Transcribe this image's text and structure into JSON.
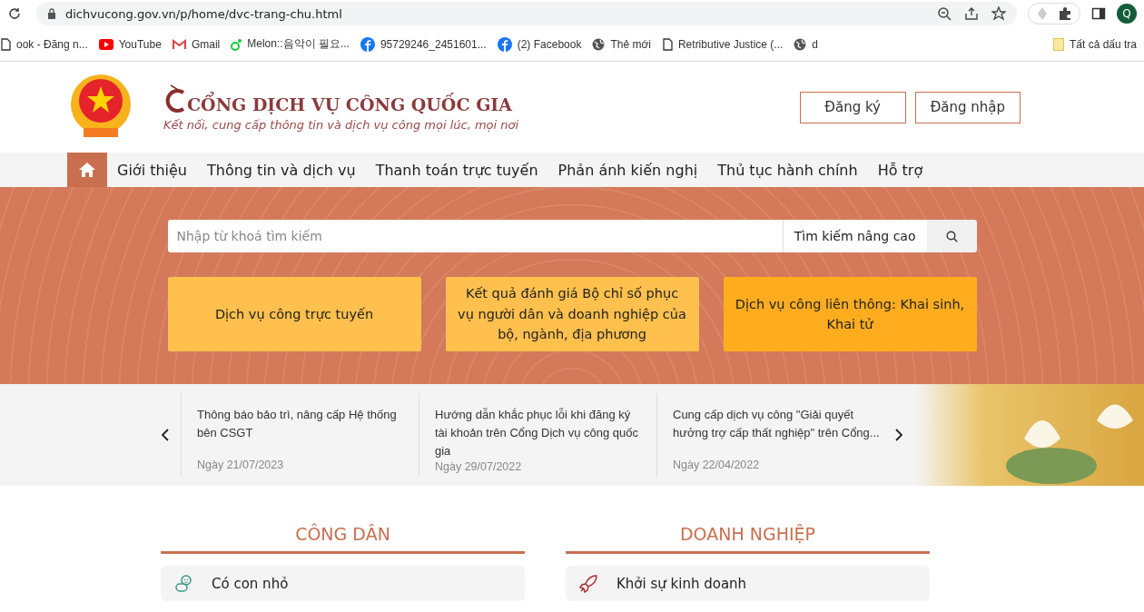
{
  "browser": {
    "url": "dichvucong.gov.vn/p/home/dvc-trang-chu.html",
    "profile_initial": "Q",
    "bookmarks": [
      {
        "label": "ook - Đăng n...",
        "kind": "page"
      },
      {
        "label": "YouTube",
        "kind": "youtube"
      },
      {
        "label": "Gmail",
        "kind": "gmail"
      },
      {
        "label": "Melon::음악이 필요...",
        "kind": "melon"
      },
      {
        "label": "95729246_2451601...",
        "kind": "facebook"
      },
      {
        "label": "(2) Facebook",
        "kind": "facebook"
      },
      {
        "label": "Thẻ mới",
        "kind": "globe"
      },
      {
        "label": "Retributive Justice (...",
        "kind": "page"
      },
      {
        "label": "d",
        "kind": "globe"
      }
    ],
    "other_bookmarks": "Tất cả dấu tra"
  },
  "header": {
    "title": "CỔNG DỊCH VỤ CÔNG QUỐC GIA",
    "tagline": "Kết nối, cung cấp thông tin và dịch vụ công mọi lúc, mọi nơi",
    "buttons": [
      "Đăng ký",
      "Đăng nhập"
    ]
  },
  "nav": [
    {
      "kind": "home",
      "selected": true
    },
    {
      "kind": "text",
      "label": "Giới thiệu",
      "selected": false
    },
    {
      "kind": "text",
      "label": "Thông tin và dịch vụ",
      "selected": false
    },
    {
      "kind": "text",
      "label": "Thanh toán trực tuyến",
      "selected": false
    },
    {
      "kind": "text",
      "label": "Phản ánh kiến nghị",
      "selected": false
    },
    {
      "kind": "text",
      "label": "Thủ tục hành chính",
      "selected": false
    },
    {
      "kind": "text",
      "label": "Hỗ trợ",
      "selected": false
    }
  ],
  "search": {
    "placeholder": "Nhập từ khoá tìm kiếm",
    "advanced": "Tìm kiếm nâng cao"
  },
  "cards": [
    {
      "label": "Dịch vụ công trực tuyến",
      "color": "#ffc04d"
    },
    {
      "label": "Kết quả đánh giá Bộ chỉ số phục vụ người dân và doanh nghiệp của bộ, ngành, địa phương",
      "color": "#ffc04d"
    },
    {
      "label": "Dịch vụ công liên thông: Khai sinh, Khai tử",
      "color": "#ffad1f"
    }
  ],
  "news": [
    {
      "title": "Thông báo bảo trì, nâng cấp Hệ thống bên CSGT",
      "date": "Ngày 21/07/2023"
    },
    {
      "title": "Hướng dẫn khắc phục lỗi khi đăng ký tài khoản trên Cổng Dịch vụ công quốc gia",
      "date": "Ngày 29/07/2022"
    },
    {
      "title": "Cung cấp dịch vụ công \"Giải quyết hưởng trợ cấp thất nghiệp\" trên Cổng...",
      "date": "Ngày 22/04/2022"
    }
  ],
  "sections": [
    {
      "heading": "CÔNG DÂN",
      "items": [
        {
          "label": "Có con nhỏ",
          "kind": "baby"
        }
      ]
    },
    {
      "heading": "DOANH NGHIỆP",
      "items": [
        {
          "label": "Khởi sự kinh doanh",
          "kind": "rocket"
        }
      ]
    }
  ]
}
